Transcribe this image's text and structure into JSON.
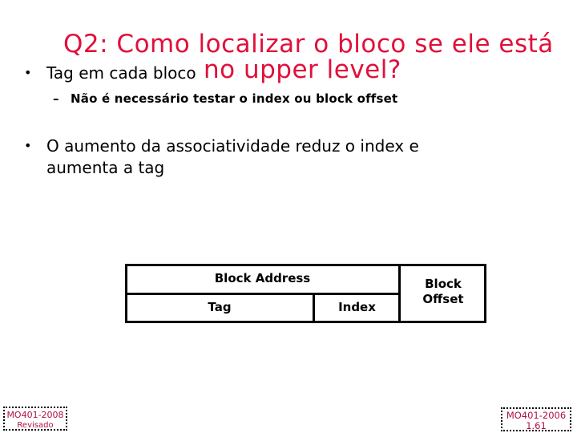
{
  "slide": {
    "title_line1": "Q2: Como localizar o bloco se ele está",
    "title_line2": "no upper level?",
    "title_color": "#e0103a",
    "bullets": [
      {
        "marker": "•",
        "text_lines": [
          "Tag em cada bloco"
        ],
        "sub_bullets": [
          {
            "marker": "–",
            "text": "Não é necessário testar o index ou block offset"
          }
        ]
      },
      {
        "marker": "•",
        "text_lines": [
          "O aumento da associatividade reduz o index e",
          "aumenta a tag"
        ]
      }
    ],
    "diagram": {
      "block_address": "Block Address",
      "tag": "Tag",
      "index": "Index",
      "block_offset_line1": "Block",
      "block_offset_line2": "Offset"
    }
  },
  "footer": {
    "left": {
      "line1": "MO401-2008",
      "line2": "Revisado"
    },
    "right": {
      "line1": "MO401-2006",
      "line2": "1.61"
    },
    "color": "#b0104a"
  }
}
